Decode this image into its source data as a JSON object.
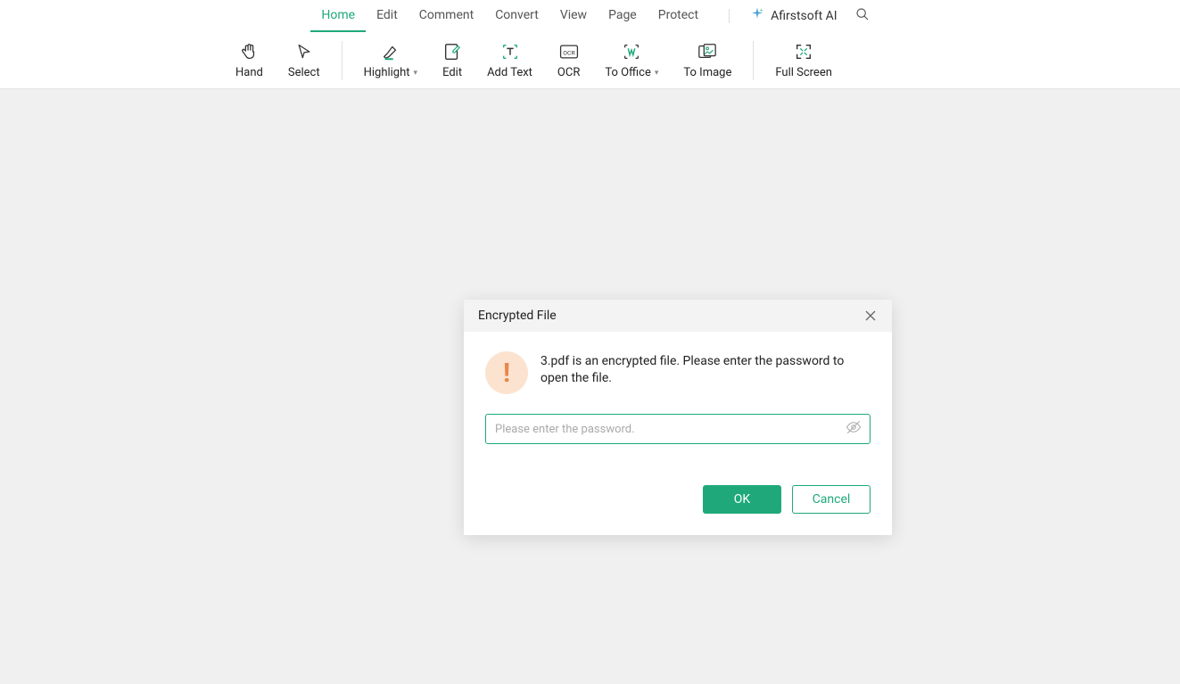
{
  "menu": {
    "tabs": [
      "Home",
      "Edit",
      "Comment",
      "Convert",
      "View",
      "Page",
      "Protect"
    ],
    "active_index": 0,
    "ai_label": "Afirstsoft AI"
  },
  "ribbon": {
    "items": [
      {
        "label": "Hand",
        "icon": "hand-icon"
      },
      {
        "label": "Select",
        "icon": "cursor-icon"
      }
    ],
    "items2": [
      {
        "label": "Highlight",
        "icon": "highlight-icon",
        "dropdown": true
      },
      {
        "label": "Edit",
        "icon": "edit-icon"
      },
      {
        "label": "Add Text",
        "icon": "add-text-icon"
      },
      {
        "label": "OCR",
        "icon": "ocr-icon"
      },
      {
        "label": "To Office",
        "icon": "to-office-icon",
        "dropdown": true
      },
      {
        "label": "To Image",
        "icon": "to-image-icon"
      }
    ],
    "items3": [
      {
        "label": "Full Screen",
        "icon": "fullscreen-icon"
      }
    ]
  },
  "dialog": {
    "title": "Encrypted File",
    "message": "3.pdf is an encrypted file. Please enter the password to open the file.",
    "placeholder": "Please enter the password.",
    "ok_label": "OK",
    "cancel_label": "Cancel"
  },
  "colors": {
    "accent": "#1fa97a",
    "warning_bg": "#fce3d0",
    "warning_fg": "#e8874a"
  }
}
